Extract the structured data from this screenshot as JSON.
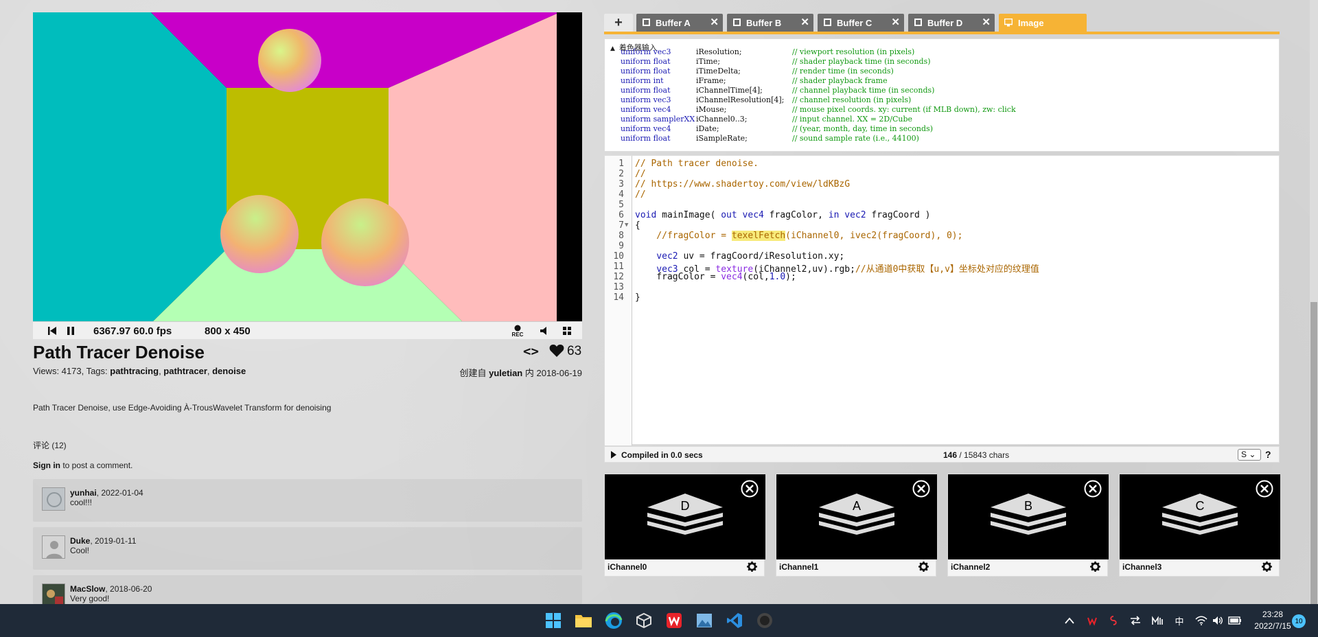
{
  "player": {
    "time_fps": "6367.97 60.0 fps",
    "resolution": "800 x 450",
    "rec_label": "REC"
  },
  "shader": {
    "title": "Path Tracer Denoise",
    "likes": "63",
    "code_toggle": "<>",
    "views_label": "Views: 4173, Tags: ",
    "tags": [
      "pathtracing",
      "pathtracer",
      "denoise"
    ],
    "created_prefix": "创建自",
    "author": "yuletian",
    "created_in": "内",
    "date": "2018-06-19",
    "description": "Path Tracer Denoise, use Edge-Avoiding À-TrousWavelet Transform for denoising"
  },
  "comments": {
    "header": "评论 (12)",
    "signin_label": "Sign in",
    "signin_suffix": " to post a comment.",
    "items": [
      {
        "user": "yunhai",
        "date": ", 2022-01-04",
        "text": "cool!!!"
      },
      {
        "user": "Duke",
        "date": ", 2019-01-11",
        "text": "Cool!"
      },
      {
        "user": "MacSlow",
        "date": ", 2018-06-20",
        "text": "Very good!"
      }
    ]
  },
  "tabs": {
    "add": "+",
    "items": [
      {
        "label": "Buffer A"
      },
      {
        "label": "Buffer B"
      },
      {
        "label": "Buffer C"
      },
      {
        "label": "Buffer D"
      },
      {
        "label": "Image"
      }
    ],
    "close_glyph": "✕"
  },
  "inputs": {
    "header": "着色器输入",
    "uniforms": [
      {
        "type": "uniform vec3",
        "name": "iResolution;",
        "comment": "// viewport resolution (in pixels)"
      },
      {
        "type": "uniform float",
        "name": "iTime;",
        "comment": "// shader playback time (in seconds)"
      },
      {
        "type": "uniform float",
        "name": "iTimeDelta;",
        "comment": "// render time (in seconds)"
      },
      {
        "type": "uniform int",
        "name": "iFrame;",
        "comment": "// shader playback frame"
      },
      {
        "type": "uniform float",
        "name": "iChannelTime[4];",
        "comment": "// channel playback time (in seconds)"
      },
      {
        "type": "uniform vec3",
        "name": "iChannelResolution[4];",
        "comment": "// channel resolution (in pixels)"
      },
      {
        "type": "uniform vec4",
        "name": "iMouse;",
        "comment": "// mouse pixel coords. xy: current (if MLB down), zw: click"
      },
      {
        "type": "uniform samplerXX",
        "name": "iChannel0..3;",
        "comment": "// input channel. XX = 2D/Cube"
      },
      {
        "type": "uniform vec4",
        "name": "iDate;",
        "comment": "// (year, month, day, time in seconds)"
      },
      {
        "type": "uniform float",
        "name": "iSampleRate;",
        "comment": "// sound sample rate (i.e., 44100)"
      }
    ]
  },
  "code": {
    "line_numbers": [
      "1",
      "2",
      "3",
      "4",
      "5",
      "6",
      "7",
      "8",
      "9",
      "10",
      "11",
      "12",
      "13",
      "14"
    ],
    "l1": "// Path tracer denoise.",
    "l2": "//",
    "l3": "// https://www.shadertoy.com/view/ldKBzG",
    "l4": "//",
    "l6_void": "void",
    "l6_name": " mainImage( ",
    "l6_out": "out",
    "l6_vec4": " vec4",
    "l6_frag": " fragColor, ",
    "l6_in": "in",
    "l6_vec2": " vec2",
    "l6_coord": " fragCoord )",
    "l7": "{",
    "l8_pre": "    //fragColor = ",
    "l8_hl": "texelFetch",
    "l8_post": "(iChannel0, ivec2(fragCoord), 0);",
    "l10_type": "    vec2",
    "l10_rest": " uv = fragCoord/iResolution.xy;",
    "l11_type": "    vec3",
    "l11_mid": " col = ",
    "l11_fn": "texture",
    "l11_rest": "(iChannel2,uv).rgb;",
    "l11_comment": "//从通道0中获取【u,v】坐标处对应的纹理值",
    "l12_pre": "    fragColor = ",
    "l12_fn": "vec4",
    "l12_rest": "(col,",
    "l12_num": "1.0",
    "l12_end": ");",
    "l14": "}"
  },
  "status": {
    "compiled": "Compiled in 0.0 secs",
    "chars_used": "146",
    "chars_total": " / 15843 chars",
    "size_option": "S",
    "help": "?"
  },
  "channels": [
    {
      "label": "iChannel0",
      "letter": "D"
    },
    {
      "label": "iChannel1",
      "letter": "A"
    },
    {
      "label": "iChannel2",
      "letter": "B"
    },
    {
      "label": "iChannel3",
      "letter": "C"
    }
  ],
  "taskbar": {
    "ime": "中",
    "time": "23:28",
    "date": "2022/7/15",
    "notifications": "10"
  },
  "colors": {
    "accent": "#f6b335",
    "tab_inactive": "#6b6b6b",
    "taskbar": "#1f2a38",
    "scene_left_wall": "#00bdbd",
    "scene_ceiling": "#c800c8",
    "scene_back_wall": "#bdbd00",
    "scene_right_wall": "#ffbcbc",
    "scene_floor": "#b4ffb4"
  }
}
